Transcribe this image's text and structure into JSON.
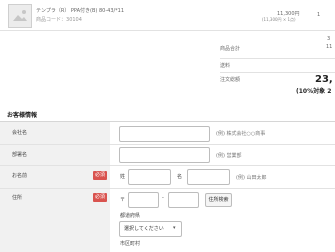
{
  "product": {
    "name": "テンプラ（R） PPA付き(B) 80-43/*11",
    "code_label": "商品コード：",
    "code": "30104",
    "price": "11,300円",
    "price_detail": "(11,300円 × 1点)",
    "quantity": "1"
  },
  "totals": {
    "fragment_top": "3",
    "subtotal_label": "商品合計",
    "subtotal_value_fragment": "11",
    "subtotal_value_fragment2": "",
    "shipping_label": "送料",
    "total_label": "注文総額",
    "total_value": "23,",
    "tax_note": "(10%対象 2"
  },
  "orderer": {
    "section_title": "お客様情報",
    "company_label": "会社名",
    "company_hint": "(例) 株式会社○○商事",
    "department_label": "部署名",
    "department_hint": "(例) 営業部",
    "name_label": "お名前",
    "required_badge": "必須",
    "surname_prefix": "姓",
    "given_prefix": "名",
    "name_hint": "(例) 山田太郎",
    "address_label": "住所",
    "zip_prefix": "〒",
    "zip_separator": "-",
    "zip_button": "住所検索",
    "prefecture_label": "都道府県",
    "prefecture_placeholder": "選択してください",
    "city_label": "市区町村"
  }
}
